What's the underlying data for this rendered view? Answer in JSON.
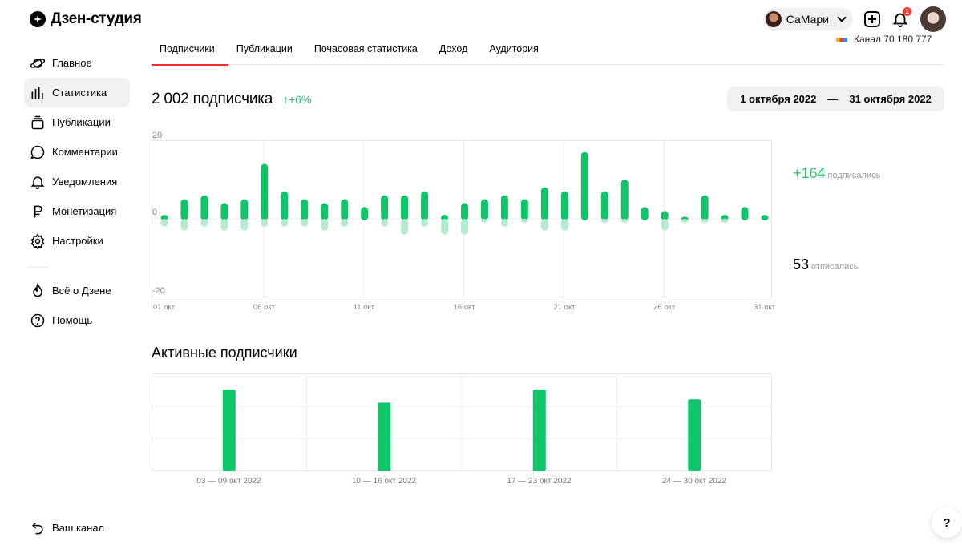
{
  "app": {
    "title": "Дзен-студия"
  },
  "header": {
    "channel_name": "СаМари",
    "notification_count": "1",
    "partial_text": "Канал 70 180 777"
  },
  "sidebar": {
    "items": [
      {
        "label": "Главное",
        "icon": "planet-icon"
      },
      {
        "label": "Статистика",
        "icon": "bar-stats-icon"
      },
      {
        "label": "Публикации",
        "icon": "stack-icon"
      },
      {
        "label": "Комментарии",
        "icon": "comment-icon"
      },
      {
        "label": "Уведомления",
        "icon": "bell-icon"
      },
      {
        "label": "Монетизация",
        "icon": "ruble-icon"
      },
      {
        "label": "Настройки",
        "icon": "gear-icon"
      }
    ],
    "extra": [
      {
        "label": "Всё о Дзене",
        "icon": "flame-icon"
      },
      {
        "label": "Помощь",
        "icon": "question-icon"
      }
    ],
    "bottom_label": "Ваш канал"
  },
  "tabs": [
    "Подписчики",
    "Публикации",
    "Почасовая статистика",
    "Доход",
    "Аудитория"
  ],
  "active_tab": 0,
  "subscribers": {
    "title": "2 002 подписчика",
    "growth": "↑+6%",
    "date_from": "1 октября 2022",
    "date_sep": "—",
    "date_to": "31 октября 2022",
    "subscribed_value": "+164",
    "subscribed_label": "подписались",
    "unsubscribed_value": "53",
    "unsubscribed_label": "отписались"
  },
  "active_subscribers": {
    "title": "Активные подписчики"
  },
  "help_label": "?",
  "colors": {
    "accent": "#ff2d2d",
    "green": "#0fc56a",
    "green_light": "#b5ecd0"
  },
  "chart_data": [
    {
      "type": "bar",
      "x": [
        "01",
        "02",
        "03",
        "04",
        "05",
        "06",
        "07",
        "08",
        "09",
        "10",
        "11",
        "12",
        "13",
        "14",
        "15",
        "16",
        "17",
        "18",
        "19",
        "20",
        "21",
        "22",
        "23",
        "24",
        "25",
        "26",
        "27",
        "28",
        "29",
        "30",
        "31"
      ],
      "xtick_labels": [
        "01 окт",
        "06 окт",
        "11 окт",
        "16 окт",
        "21 окт",
        "26 окт",
        "31 окт"
      ],
      "ylim": [
        -20,
        20
      ],
      "yticks": [
        "20",
        "0",
        "-20"
      ],
      "series": [
        {
          "values": [
            1,
            5,
            6,
            4,
            5,
            14,
            7,
            5,
            4,
            5,
            3,
            6,
            6,
            7,
            1,
            4,
            5,
            6,
            5,
            8,
            7,
            17,
            7,
            10,
            3,
            2,
            0.5,
            6,
            1,
            3,
            1
          ]
        },
        {
          "values": [
            -2,
            -3,
            -2,
            -3,
            -3,
            -2,
            -2,
            -2,
            -3,
            -2,
            0,
            -2,
            -4,
            -2,
            -4,
            -4,
            -1,
            -2,
            -1,
            -3,
            -3,
            0,
            -1,
            -1,
            0,
            -3,
            -1,
            -1,
            -1,
            0,
            0
          ]
        }
      ]
    },
    {
      "type": "bar",
      "categories": [
        "03 — 09 окт 2022",
        "10 — 16 окт 2022",
        "17 — 23 окт 2022",
        "24 — 30 окт 2022"
      ],
      "values": [
        100,
        84,
        100,
        88
      ]
    }
  ]
}
